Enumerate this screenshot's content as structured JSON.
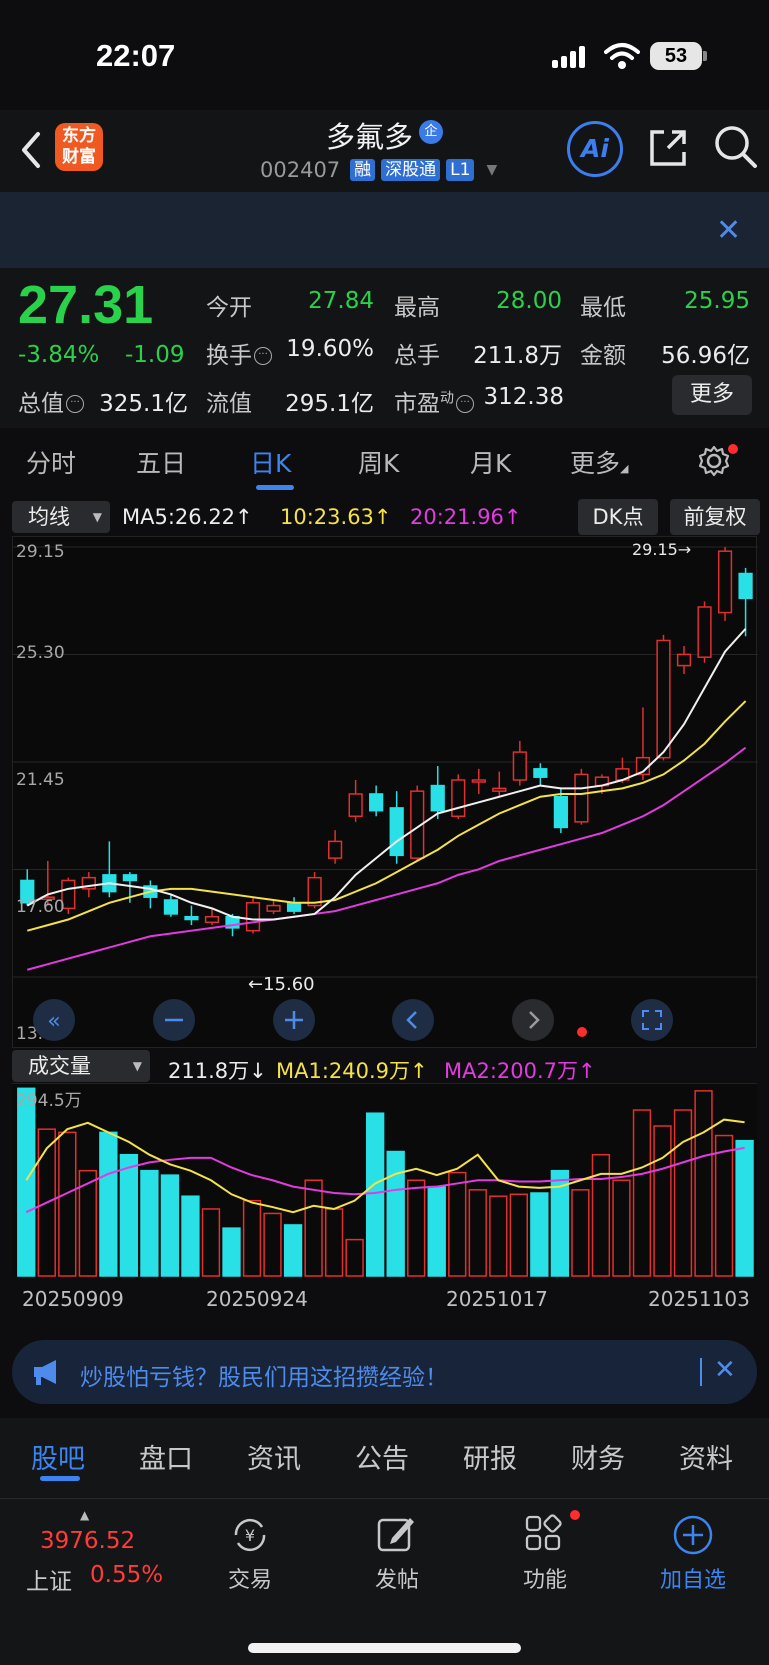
{
  "status_bar": {
    "time": "22:07",
    "battery": "53"
  },
  "header": {
    "logo_line1": "东方",
    "logo_line2": "财富",
    "stock_name": "多氟多",
    "name_badge": "企",
    "code": "002407",
    "tags": [
      "融",
      "深股通",
      "L1"
    ],
    "ai_label": "Ai"
  },
  "quote": {
    "price": "27.31",
    "change_pct": "-3.84%",
    "change": "-1.09",
    "rows": [
      [
        {
          "label": "今开",
          "value": "27.84"
        },
        {
          "label": "最高",
          "value": "28.00"
        },
        {
          "label": "最低",
          "value": "25.95"
        }
      ],
      [
        {
          "label": "换手",
          "value": "19.60%"
        },
        {
          "label": "总手",
          "value": "211.8万"
        },
        {
          "label": "金额",
          "value": "56.96亿"
        }
      ],
      [
        {
          "label": "总值",
          "value": "325.1亿"
        },
        {
          "label": "流值",
          "value": "295.1亿"
        },
        {
          "label": "市盈",
          "value": "312.38",
          "sup": "动"
        }
      ]
    ],
    "more_label": "更多"
  },
  "chart_tabs": [
    "分时",
    "五日",
    "日K",
    "周K",
    "月K",
    "更多"
  ],
  "ma_row": {
    "selector": "均线",
    "ma5": "MA5:26.22",
    "ma10": "10:23.63",
    "ma20": "20:21.96",
    "dk_label": "DK点",
    "fq_label": "前复权"
  },
  "volume_row": {
    "selector": "成交量",
    "vol": "211.8万",
    "ma1": "MA1:240.9万",
    "ma2": "MA2:200.7万"
  },
  "chart_data": [
    {
      "type": "candlestick",
      "y_tick_labels": [
        "29.15",
        "25.30",
        "21.45",
        "17.60",
        "13.74"
      ],
      "ylim": [
        13.74,
        29.15
      ],
      "annotations": [
        "29.15→",
        "←15.60"
      ],
      "x_tick_labels": [
        "20250909",
        "20250924",
        "20251017",
        "20251103"
      ],
      "candles": [
        {
          "o": 17.2,
          "c": 16.4,
          "h": 17.6,
          "l": 16.3
        },
        {
          "o": 16.6,
          "c": 16.6,
          "h": 17.9,
          "l": 16.3
        },
        {
          "o": 16.2,
          "c": 17.2,
          "h": 17.3,
          "l": 16.0
        },
        {
          "o": 16.9,
          "c": 17.3,
          "h": 17.5,
          "l": 16.6
        },
        {
          "o": 17.4,
          "c": 16.8,
          "h": 18.6,
          "l": 16.6
        },
        {
          "o": 17.4,
          "c": 17.2,
          "h": 17.5,
          "l": 16.4
        },
        {
          "o": 17.0,
          "c": 16.6,
          "h": 17.2,
          "l": 16.2
        },
        {
          "o": 16.5,
          "c": 16.0,
          "h": 16.7,
          "l": 15.9
        },
        {
          "o": 15.9,
          "c": 15.8,
          "h": 16.3,
          "l": 15.6
        },
        {
          "o": 15.7,
          "c": 15.9,
          "h": 16.2,
          "l": 15.6
        },
        {
          "o": 15.9,
          "c": 15.5,
          "h": 16.0,
          "l": 15.2
        },
        {
          "o": 15.4,
          "c": 16.4,
          "h": 16.6,
          "l": 15.3
        },
        {
          "o": 16.1,
          "c": 16.3,
          "h": 16.5,
          "l": 16.0
        },
        {
          "o": 16.4,
          "c": 16.1,
          "h": 16.6,
          "l": 16.0
        },
        {
          "o": 16.3,
          "c": 17.3,
          "h": 17.5,
          "l": 16.2
        },
        {
          "o": 18.0,
          "c": 18.6,
          "h": 19.0,
          "l": 17.8
        },
        {
          "o": 19.5,
          "c": 20.3,
          "h": 20.8,
          "l": 19.3
        },
        {
          "o": 20.3,
          "c": 19.7,
          "h": 20.6,
          "l": 19.5
        },
        {
          "o": 19.8,
          "c": 18.1,
          "h": 20.4,
          "l": 17.8
        },
        {
          "o": 18.0,
          "c": 20.4,
          "h": 20.6,
          "l": 17.9
        },
        {
          "o": 20.6,
          "c": 19.7,
          "h": 21.3,
          "l": 19.4
        },
        {
          "o": 19.5,
          "c": 20.8,
          "h": 21.0,
          "l": 19.4
        },
        {
          "o": 20.8,
          "c": 20.8,
          "h": 21.2,
          "l": 20.3
        },
        {
          "o": 20.4,
          "c": 20.5,
          "h": 21.1,
          "l": 20.2
        },
        {
          "o": 20.8,
          "c": 21.8,
          "h": 22.2,
          "l": 20.6
        },
        {
          "o": 21.2,
          "c": 20.9,
          "h": 21.4,
          "l": 20.6
        },
        {
          "o": 20.2,
          "c": 19.1,
          "h": 20.5,
          "l": 18.9
        },
        {
          "o": 19.3,
          "c": 21.0,
          "h": 21.2,
          "l": 19.2
        },
        {
          "o": 20.6,
          "c": 20.9,
          "h": 21.0,
          "l": 20.3
        },
        {
          "o": 20.8,
          "c": 21.2,
          "h": 21.6,
          "l": 20.7
        },
        {
          "o": 21.0,
          "c": 21.6,
          "h": 23.4,
          "l": 20.8
        },
        {
          "o": 21.6,
          "c": 25.8,
          "h": 26.0,
          "l": 21.5
        },
        {
          "o": 24.9,
          "c": 25.3,
          "h": 25.6,
          "l": 24.6
        },
        {
          "o": 25.2,
          "c": 27.0,
          "h": 27.2,
          "l": 25.0
        },
        {
          "o": 26.8,
          "c": 29.0,
          "h": 29.15,
          "l": 26.5
        },
        {
          "o": 28.2,
          "c": 27.31,
          "h": 28.4,
          "l": 25.95
        }
      ],
      "ma5": [
        16.3,
        16.7,
        16.9,
        17.0,
        17.1,
        17.0,
        16.9,
        16.7,
        16.4,
        16.2,
        15.9,
        15.8,
        15.8,
        15.9,
        16.0,
        16.6,
        17.4,
        18.0,
        18.6,
        19.1,
        19.6,
        19.8,
        20.0,
        20.2,
        20.4,
        20.6,
        20.5,
        20.5,
        20.6,
        20.8,
        21.1,
        21.8,
        22.8,
        24.1,
        25.4,
        26.22
      ],
      "ma10": [
        15.4,
        15.6,
        15.8,
        16.1,
        16.4,
        16.6,
        16.8,
        16.9,
        16.9,
        16.8,
        16.7,
        16.6,
        16.5,
        16.4,
        16.4,
        16.5,
        16.8,
        17.1,
        17.5,
        17.9,
        18.3,
        18.8,
        19.2,
        19.6,
        19.9,
        20.2,
        20.3,
        20.3,
        20.4,
        20.5,
        20.7,
        21.0,
        21.5,
        22.1,
        22.9,
        23.63
      ],
      "ma20": [
        14.0,
        14.2,
        14.4,
        14.6,
        14.8,
        15.0,
        15.2,
        15.3,
        15.4,
        15.5,
        15.6,
        15.7,
        15.8,
        15.9,
        16.0,
        16.1,
        16.3,
        16.5,
        16.7,
        16.9,
        17.1,
        17.4,
        17.6,
        17.9,
        18.1,
        18.3,
        18.5,
        18.7,
        18.9,
        19.2,
        19.5,
        19.9,
        20.4,
        20.9,
        21.4,
        21.96
      ]
    },
    {
      "type": "bar",
      "y_tick_labels": [
        "294.5万"
      ],
      "ylim": [
        0,
        294.5
      ],
      "volumes": [
        294,
        230,
        225,
        165,
        225,
        190,
        165,
        158,
        125,
        105,
        75,
        118,
        98,
        80,
        150,
        105,
        57,
        255,
        195,
        150,
        140,
        162,
        135,
        125,
        128,
        130,
        165,
        135,
        190,
        150,
        260,
        235,
        260,
        290,
        220,
        212
      ],
      "ma1": [
        150,
        200,
        230,
        240,
        225,
        210,
        190,
        175,
        165,
        150,
        128,
        115,
        108,
        100,
        110,
        105,
        118,
        145,
        160,
        168,
        158,
        168,
        190,
        150,
        140,
        138,
        140,
        150,
        160,
        160,
        170,
        185,
        210,
        225,
        245,
        240.9
      ],
      "ma2": [
        100,
        115,
        130,
        145,
        160,
        170,
        178,
        182,
        185,
        185,
        170,
        158,
        150,
        140,
        135,
        130,
        128,
        130,
        135,
        138,
        140,
        145,
        150,
        150,
        148,
        148,
        150,
        152,
        152,
        155,
        160,
        168,
        178,
        188,
        195,
        200.7
      ]
    }
  ],
  "ad": {
    "text": "炒股怕亏钱？股民们用这招攒经验！"
  },
  "sub_tabs": [
    "股吧",
    "盘口",
    "资讯",
    "公告",
    "研报",
    "财务",
    "资料"
  ],
  "bottom_nav": {
    "index_value": "3976.52",
    "index_name": "上证",
    "index_pct": "0.55%",
    "items": [
      "交易",
      "发帖",
      "功能",
      "加自选"
    ]
  }
}
